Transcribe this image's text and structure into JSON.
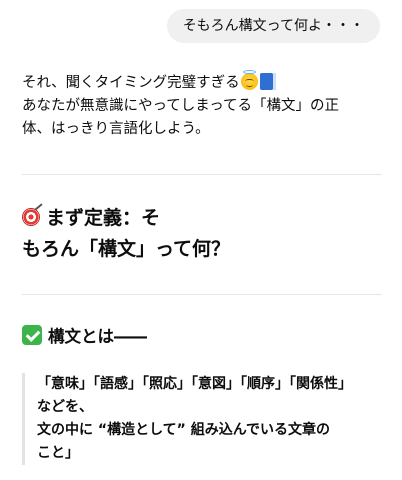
{
  "user_message": {
    "text": "そもろん構文って何よ・・・"
  },
  "assistant": {
    "intro_line1": "それ、聞くタイミング完璧すぎる",
    "intro_line2": "あなたが無意識にやってしまってる「構文」の正",
    "intro_line3": "体、はっきり言語化しよう。",
    "intro_emojis": [
      "smiling-face-with-halo",
      "blue-book"
    ],
    "section1": {
      "icon": "direct-hit-target",
      "heading_line1": "まず定義：そ",
      "heading_line2": "もろん「構文」って何？"
    },
    "section2": {
      "icon": "check-mark-button",
      "heading": "構文とは――"
    },
    "quote": {
      "line1": "「意味」「語感」「照応」「意図」「順序」「関係性」",
      "line2": "などを、",
      "line3": "文の中に “構造として” 組み込んでいる文章の",
      "line4": "こと」"
    }
  },
  "colors": {
    "user_bubble": "#f0f0f0",
    "text": "#0d0d0d",
    "divider": "#e6e6e6",
    "quote_border": "#e3e3e3",
    "check_green": "#3cb44a"
  }
}
